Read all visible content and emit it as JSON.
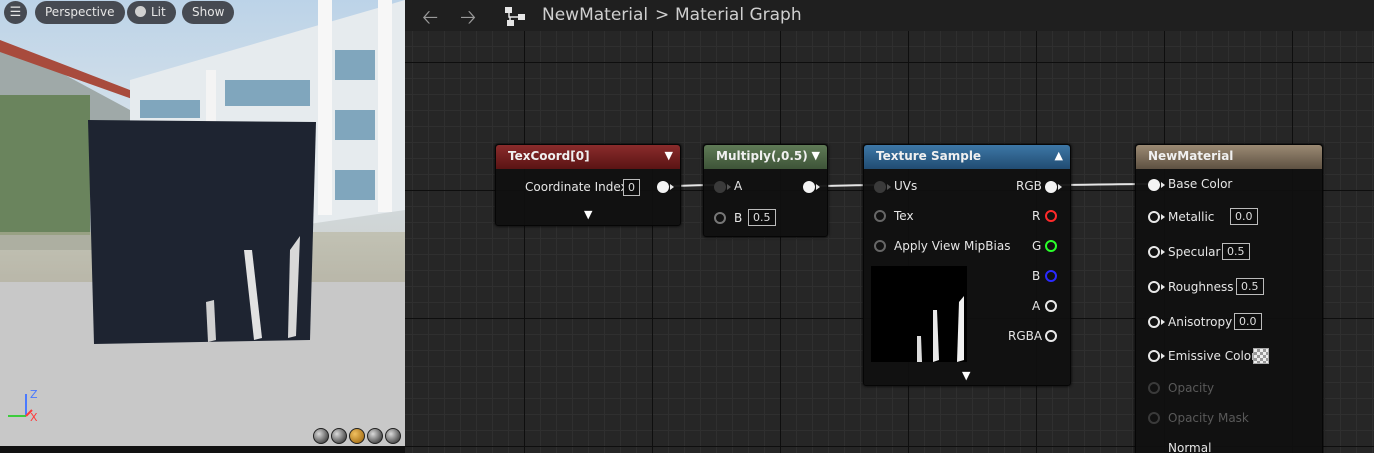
{
  "viewport": {
    "menu_icon": "hamburger-icon",
    "perspective_label": "Perspective",
    "lit_label": "Lit",
    "show_label": "Show",
    "axis_z": "Z",
    "axis_x": "X"
  },
  "graph": {
    "breadcrumb_asset": "NewMaterial",
    "breadcrumb_separator": ">",
    "breadcrumb_graph": "Material Graph"
  },
  "nodes": {
    "texcoord": {
      "title": "TexCoord[0]",
      "coordinate_index_label": "Coordinate Index",
      "coordinate_index_value": "0"
    },
    "multiply": {
      "title": "Multiply(,0.5)",
      "input_a": "A",
      "input_b": "B",
      "b_value": "0.5"
    },
    "texture_sample": {
      "title": "Texture Sample",
      "inputs": [
        "UVs",
        "Tex",
        "Apply View MipBias"
      ],
      "outputs": [
        "RGB",
        "R",
        "G",
        "B",
        "A",
        "RGBA"
      ]
    },
    "new_material": {
      "title": "NewMaterial",
      "base_color": "Base Color",
      "metallic": "Metallic",
      "metallic_value": "0.0",
      "specular": "Specular",
      "specular_value": "0.5",
      "roughness": "Roughness",
      "roughness_value": "0.5",
      "anisotropy": "Anisotropy",
      "anisotropy_value": "0.0",
      "emissive_color": "Emissive Color",
      "opacity": "Opacity",
      "opacity_mask": "Opacity Mask",
      "normal": "Normal"
    }
  },
  "colors": {
    "texcoord_header": "#7a2222",
    "multiply_header": "#4f6a46",
    "texture_sample_header": "#2d5f8a",
    "new_material_header": "#7d6e5b",
    "pin_r": "#ff2a2a",
    "pin_g": "#2aff2a",
    "pin_b": "#2a2aff"
  }
}
